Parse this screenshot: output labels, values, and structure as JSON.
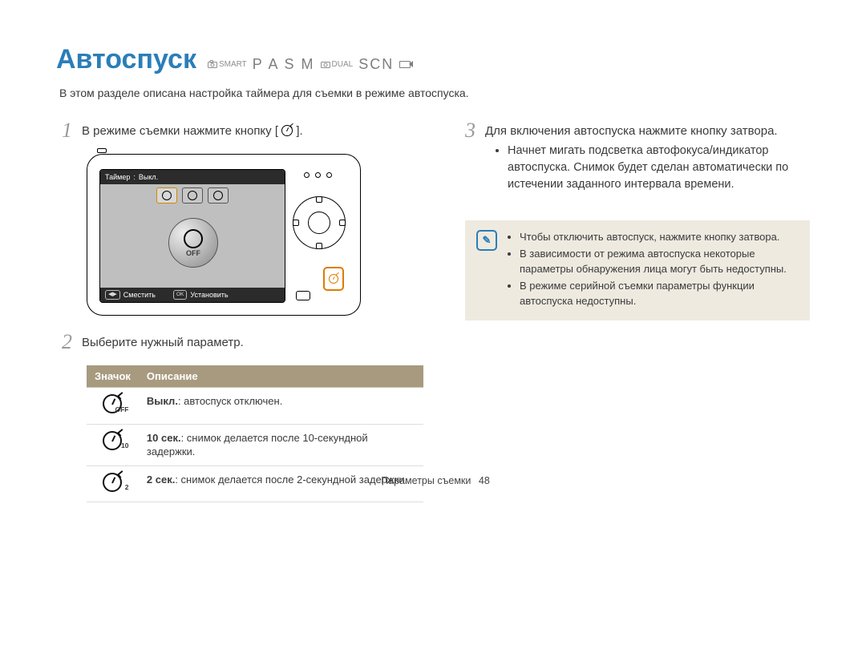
{
  "title": "Автоспуск",
  "modes": {
    "smart_label": "SMART",
    "pasm": "P A S M",
    "dual_label": "DUAL",
    "scn": "SCN"
  },
  "intro": "В этом разделе описана настройка таймера для съемки в режиме автоспуска.",
  "steps": {
    "s1": "В режиме съемки нажмите кнопку [",
    "s1_end": "].",
    "s2": "Выберите нужный параметр.",
    "s3": "Для включения автоспуска нажмите кнопку затвора.",
    "s3_bullets": [
      "Начнет мигать подсветка автофокуса/индикатор автоспуска. Снимок будет сделан автоматически по истечении заданного интервала времени."
    ]
  },
  "camera_screen": {
    "top_left": "Таймер",
    "top_sep": ":",
    "top_right": "Выкл.",
    "big_label": "OFF",
    "bot_move_key": "◀▶",
    "bot_move": "Сместить",
    "bot_ok_key": "OK",
    "bot_ok": "Установить"
  },
  "table": {
    "head_icon": "Значок",
    "head_desc": "Описание",
    "rows": [
      {
        "sub": "OFF",
        "bold": "Выкл.",
        "text": ": автоспуск отключен."
      },
      {
        "sub": "10",
        "bold": "10 сек.",
        "text": ": снимок делается после 10-секундной задержки."
      },
      {
        "sub": "2",
        "bold": "2 сек.",
        "text": ": снимок делается после 2-секундной задержки."
      }
    ]
  },
  "notes": [
    "Чтобы отключить автоспуск, нажмите кнопку затвора.",
    "В зависимости от режима автоспуска некоторые параметры обнаружения лица могут быть недоступны.",
    "В режиме серийной съемки параметры функции автоспуска недоступны."
  ],
  "note_icon_glyph": "✎",
  "footer": {
    "section": "Параметры съемки",
    "page": "48"
  }
}
